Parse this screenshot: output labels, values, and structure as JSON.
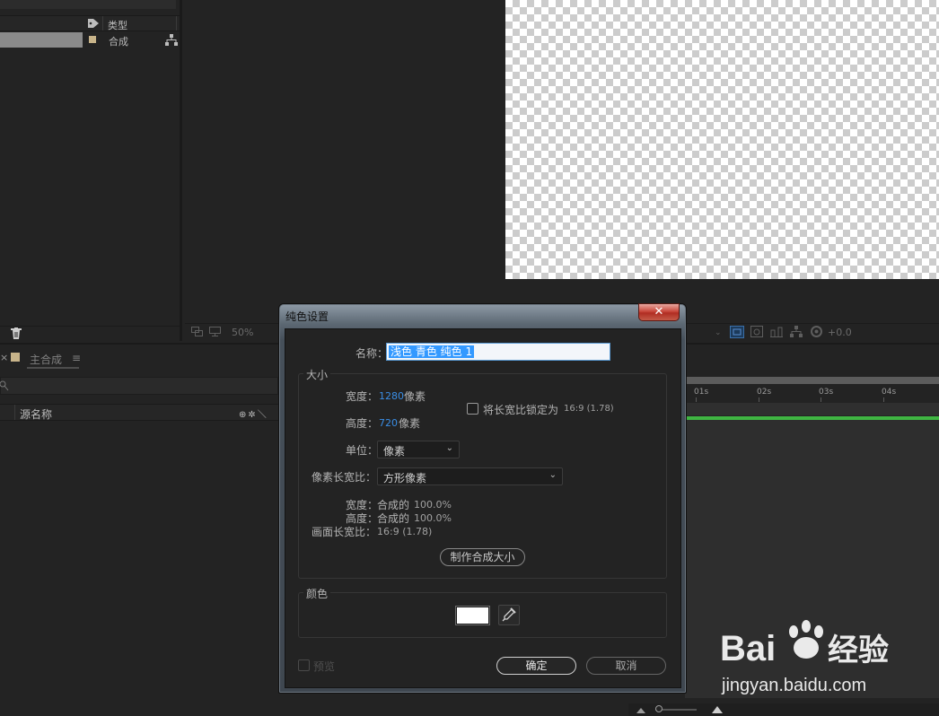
{
  "project": {
    "type_column": "类型",
    "item_type": "合成"
  },
  "viewer": {
    "zoom": "50%",
    "exposure": "+0.0"
  },
  "timeline": {
    "close_glyph": "×",
    "tab_label": "主合成",
    "menu_glyph": "≡",
    "source_name_header": "源名称",
    "switch_icons": "⊕✲＼",
    "ruler_ticks": [
      "01s",
      "02s",
      "03s",
      "04s"
    ]
  },
  "dialog": {
    "title": "纯色设置",
    "close_glyph": "✕",
    "name_label": "名称：",
    "name_value": "浅色 青色 纯色 1",
    "size_group": "大小",
    "width_label": "宽度：",
    "width_value": "1280",
    "height_label": "高度：",
    "height_value": "720",
    "pixel_unit": "像素",
    "lock_label": "将长宽比锁定为",
    "lock_ratio": "16:9 (1.78)",
    "lock_checked": false,
    "units_label": "单位：",
    "units_value": "像素",
    "par_label": "像素长宽比：",
    "par_value": "方形像素",
    "pct_width_label": "宽度：",
    "pct_width_value": "合成的",
    "pct_width_pct": "100.0%",
    "pct_height_label": "高度：",
    "pct_height_value": "合成的",
    "pct_height_pct": "100.0%",
    "frame_ratio_label": "画面长宽比：",
    "frame_ratio_value": "16:9 (1.78)",
    "make_comp_size": "制作合成大小",
    "color_group": "颜色",
    "color_value": "#ffffff",
    "preview_label": "预览",
    "ok_label": "确定",
    "cancel_label": "取消"
  },
  "watermark": {
    "brand_left": "Bai",
    "brand_right": "经验",
    "url": "jingyan.baidu.com"
  },
  "colors": {
    "accent_blue": "#3a8ee6",
    "selection_blue": "#3399ff",
    "duration_green": "#3fb542",
    "close_red": "#c9483c"
  }
}
